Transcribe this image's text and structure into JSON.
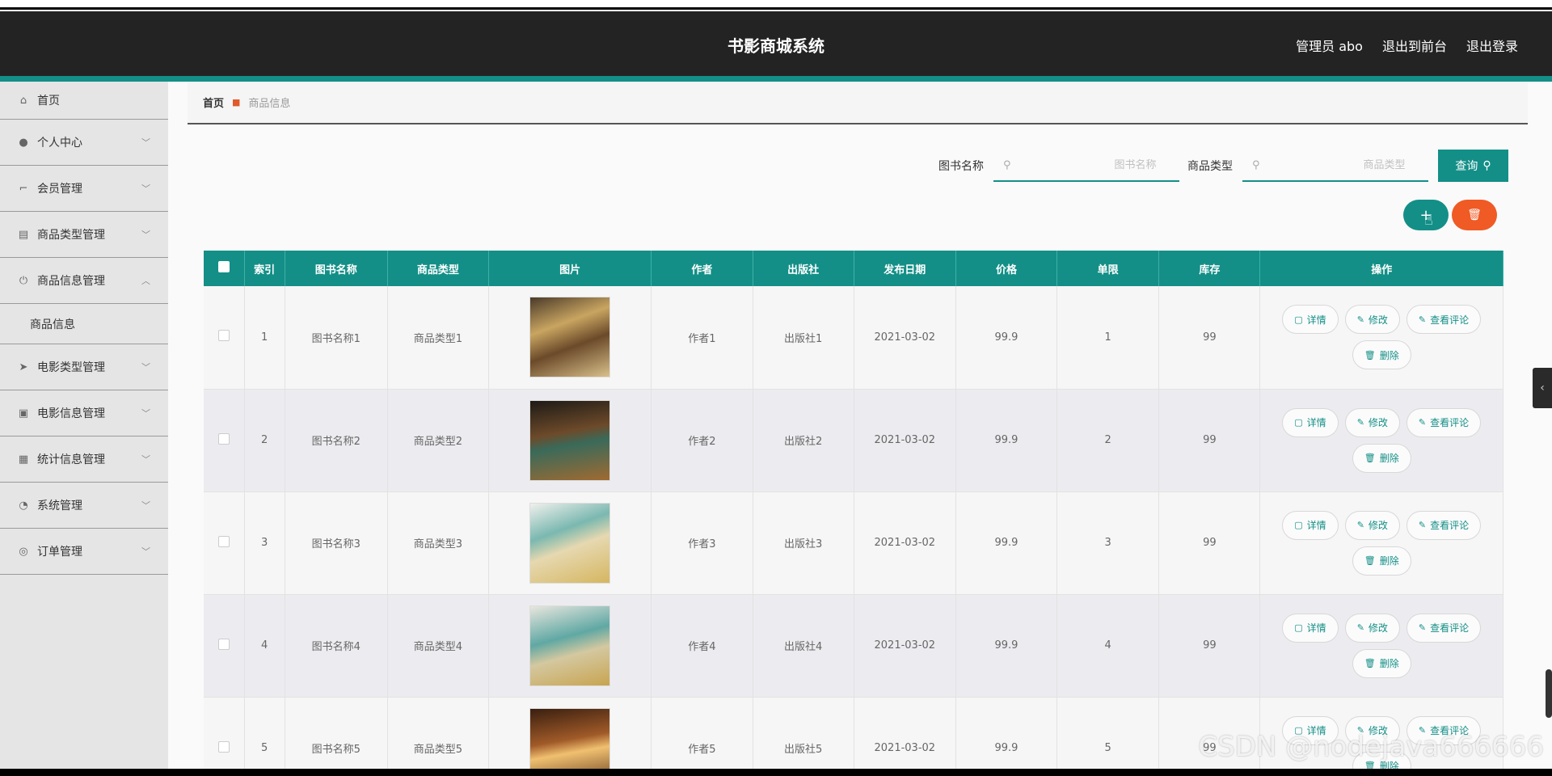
{
  "header": {
    "title": "书影商城系统",
    "nav": [
      "管理员 abo",
      "退出到前台",
      "退出登录"
    ]
  },
  "sidebar": {
    "items": [
      {
        "label": "首页",
        "icon": "home-icon",
        "glyph": "⌂"
      },
      {
        "label": "个人中心",
        "icon": "user-icon",
        "glyph": "●"
      },
      {
        "label": "会员管理",
        "icon": "crop-icon",
        "glyph": "⌐"
      },
      {
        "label": "商品类型管理",
        "icon": "clipboard-icon",
        "glyph": "▤"
      },
      {
        "label": "商品信息管理",
        "icon": "power-icon",
        "glyph": "⏻"
      },
      {
        "label": "商品信息",
        "sub": true
      },
      {
        "label": "电影类型管理",
        "icon": "send-icon",
        "glyph": "➤"
      },
      {
        "label": "电影信息管理",
        "icon": "calendar-x-icon",
        "glyph": "▣"
      },
      {
        "label": "统计信息管理",
        "icon": "grid-icon",
        "glyph": "▦"
      },
      {
        "label": "系统管理",
        "icon": "clock-icon",
        "glyph": "◔"
      },
      {
        "label": "订单管理",
        "icon": "compass-icon",
        "glyph": "◎"
      }
    ]
  },
  "breadcrumb": {
    "home": "首页",
    "current": "商品信息"
  },
  "search": {
    "name_label": "图书名称",
    "name_placeholder": "图书名称",
    "type_label": "商品类型",
    "type_placeholder": "商品类型",
    "query_label": "查询"
  },
  "table": {
    "headers": [
      "",
      "索引",
      "图书名称",
      "商品类型",
      "图片",
      "作者",
      "出版社",
      "发布日期",
      "价格",
      "单限",
      "库存",
      "操作"
    ],
    "rows": [
      {
        "index": "1",
        "name": "图书名称1",
        "type": "商品类型1",
        "author": "作者1",
        "publisher": "出版社1",
        "date": "2021-03-02",
        "price": "99.9",
        "limit": "1",
        "stock": "99"
      },
      {
        "index": "2",
        "name": "图书名称2",
        "type": "商品类型2",
        "author": "作者2",
        "publisher": "出版社2",
        "date": "2021-03-02",
        "price": "99.9",
        "limit": "2",
        "stock": "99"
      },
      {
        "index": "3",
        "name": "图书名称3",
        "type": "商品类型3",
        "author": "作者3",
        "publisher": "出版社3",
        "date": "2021-03-02",
        "price": "99.9",
        "limit": "3",
        "stock": "99"
      },
      {
        "index": "4",
        "name": "图书名称4",
        "type": "商品类型4",
        "author": "作者4",
        "publisher": "出版社4",
        "date": "2021-03-02",
        "price": "99.9",
        "limit": "4",
        "stock": "99"
      },
      {
        "index": "5",
        "name": "图书名称5",
        "type": "商品类型5",
        "author": "作者5",
        "publisher": "出版社5",
        "date": "2021-03-02",
        "price": "99.9",
        "limit": "5",
        "stock": "99"
      }
    ],
    "actions": {
      "detail": "详情",
      "edit": "修改",
      "review": "查看评论",
      "delete": "删除"
    }
  },
  "watermark": "CSDN @nodejava666666",
  "colors": {
    "accent": "#138f87",
    "danger": "#f05a24",
    "header": "#232323"
  }
}
